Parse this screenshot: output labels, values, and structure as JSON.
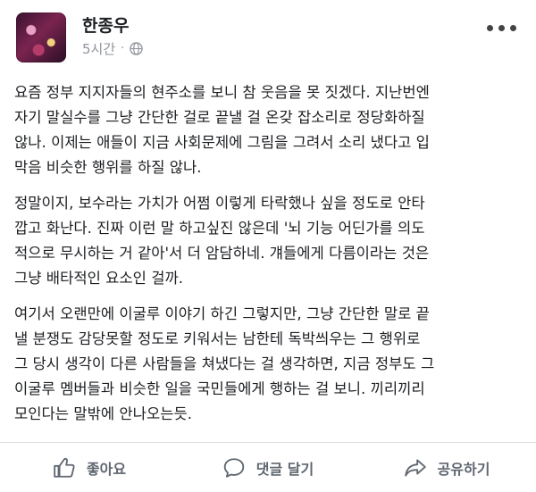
{
  "post": {
    "author": "한종우",
    "time": "5시간",
    "separator": "·",
    "paragraphs": [
      [
        "요즘 정부 지지자들의 현주소를 보니 참 웃음을 못 짓겠다. 지난번엔",
        "자기 말실수를 그냥 간단한 걸로 끝낼 걸 온갖 잡소리로 정당화하질",
        "않나. 이제는 애들이 지금 사회문제에 그림을 그려서 소리 냈다고 입",
        "막음 비슷한 행위를 하질 않나."
      ],
      [
        "정말이지, 보수라는 가치가 어쩜 이렇게 타락했나 싶을 정도로 안타",
        "깝고 화난다. 진짜 이런 말 하고싶진 않은데 '뇌 기능 어딘가를 의도",
        "적으로 무시하는 거 같아'서 더 암담하네. 걔들에게 다름이라는 것은",
        "그냥 배타적인 요소인 걸까."
      ],
      [
        "여기서 오랜만에 이굴루 이야기 하긴 그렇지만, 그냥 간단한 말로 끝",
        "낼 분쟁도 감당못할 정도로 키워서는 남한테 독박씌우는 그 행위로",
        "그 당시 생각이 다른 사람들을 쳐냈다는 걸 생각하면, 지금 정부도 그",
        "이굴루 멤버들과 비슷한 일을 국민들에게 행하는 걸 보니. 끼리끼리",
        "모인다는 말밖에 안나오는듯."
      ]
    ]
  },
  "actions": {
    "like": "좋아요",
    "comment": "댓글 달기",
    "share": "공유하기"
  },
  "icons": {
    "avatar": "profile-picture",
    "privacy": "globe-icon",
    "more": "more-options-icon",
    "like": "thumbs-up-icon",
    "comment": "speech-bubble-icon",
    "share": "share-arrow-icon"
  },
  "colors": {
    "text": "#1c1e21",
    "meta": "#90949c",
    "action": "#606770"
  }
}
